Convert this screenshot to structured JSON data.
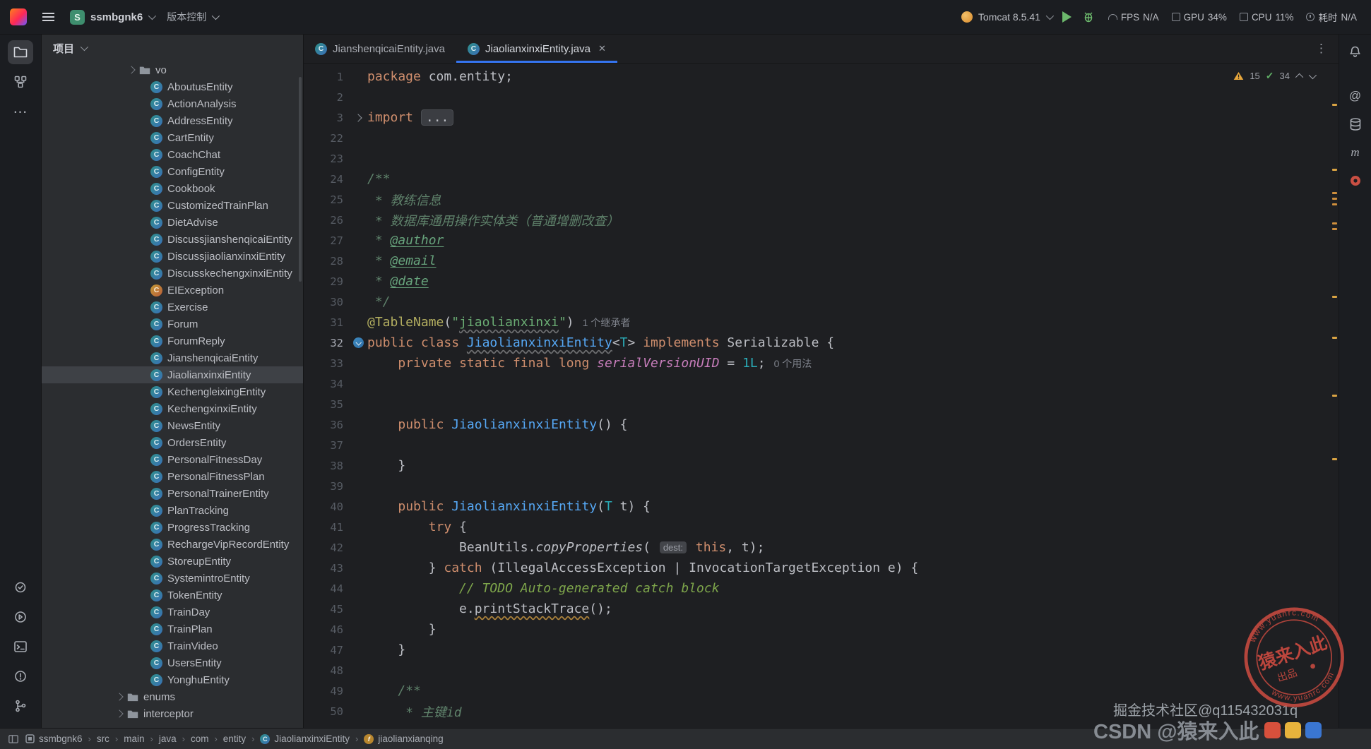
{
  "titlebar": {
    "project_badge": "S",
    "project_name": "ssmbgnk6",
    "vcs_label": "版本控制",
    "run_config": "Tomcat 8.5.41",
    "stats": [
      {
        "key": "fps",
        "icon": "gauge",
        "label": "FPS",
        "value": "N/A"
      },
      {
        "key": "gpu",
        "icon": "chip",
        "label": "GPU",
        "value": "34%"
      },
      {
        "key": "cpu",
        "icon": "chip",
        "label": "CPU",
        "value": "11%"
      },
      {
        "key": "time",
        "icon": "clock",
        "label": "耗时",
        "value": "N/A"
      }
    ]
  },
  "left_toolbar": {
    "top": [
      {
        "name": "project",
        "active": true
      },
      {
        "name": "structure",
        "active": false
      },
      {
        "name": "more",
        "active": false
      }
    ],
    "bottom": [
      {
        "name": "commit"
      },
      {
        "name": "services"
      },
      {
        "name": "terminal"
      },
      {
        "name": "problems"
      },
      {
        "name": "git"
      }
    ]
  },
  "right_toolbar": {
    "icons": [
      {
        "name": "notifications",
        "gap": true
      },
      {
        "name": "ai"
      },
      {
        "name": "database"
      },
      {
        "name": "maven"
      },
      {
        "name": "plugin"
      }
    ]
  },
  "project_panel": {
    "title": "项目",
    "items": [
      {
        "label": "vo",
        "icon": "folder",
        "chev": true,
        "ind": 123
      },
      {
        "label": "AboutusEntity",
        "icon": "class",
        "sp": true,
        "ind": 133
      },
      {
        "label": "ActionAnalysis",
        "icon": "class",
        "sp": true,
        "ind": 133
      },
      {
        "label": "AddressEntity",
        "icon": "class",
        "sp": true,
        "ind": 133
      },
      {
        "label": "CartEntity",
        "icon": "class",
        "sp": true,
        "ind": 133
      },
      {
        "label": "CoachChat",
        "icon": "class",
        "sp": true,
        "ind": 133
      },
      {
        "label": "ConfigEntity",
        "icon": "class",
        "sp": true,
        "ind": 133
      },
      {
        "label": "Cookbook",
        "icon": "class",
        "sp": true,
        "ind": 133
      },
      {
        "label": "CustomizedTrainPlan",
        "icon": "class",
        "sp": true,
        "ind": 133
      },
      {
        "label": "DietAdvise",
        "icon": "class",
        "sp": true,
        "ind": 133
      },
      {
        "label": "DiscussjianshenqicaiEntity",
        "icon": "class",
        "sp": true,
        "ind": 133
      },
      {
        "label": "DiscussjiaolianxinxiEntity",
        "icon": "class",
        "sp": true,
        "ind": 133
      },
      {
        "label": "DiscusskechengxinxiEntity",
        "icon": "class",
        "sp": true,
        "ind": 133
      },
      {
        "label": "EIException",
        "icon": "classx",
        "sp": true,
        "ind": 133
      },
      {
        "label": "Exercise",
        "icon": "class",
        "sp": true,
        "ind": 133
      },
      {
        "label": "Forum",
        "icon": "class",
        "sp": true,
        "ind": 133
      },
      {
        "label": "ForumReply",
        "icon": "class",
        "sp": true,
        "ind": 133
      },
      {
        "label": "JianshenqicaiEntity",
        "icon": "class",
        "sp": true,
        "ind": 133
      },
      {
        "label": "JiaolianxinxiEntity",
        "icon": "class",
        "sp": true,
        "ind": 133,
        "selected": true
      },
      {
        "label": "KechengleixingEntity",
        "icon": "class",
        "sp": true,
        "ind": 133
      },
      {
        "label": "KechengxinxiEntity",
        "icon": "class",
        "sp": true,
        "ind": 133
      },
      {
        "label": "NewsEntity",
        "icon": "class",
        "sp": true,
        "ind": 133
      },
      {
        "label": "OrdersEntity",
        "icon": "class",
        "sp": true,
        "ind": 133
      },
      {
        "label": "PersonalFitnessDay",
        "icon": "class",
        "sp": true,
        "ind": 133
      },
      {
        "label": "PersonalFitnessPlan",
        "icon": "class",
        "sp": true,
        "ind": 133
      },
      {
        "label": "PersonalTrainerEntity",
        "icon": "class",
        "sp": true,
        "ind": 133
      },
      {
        "label": "PlanTracking",
        "icon": "class",
        "sp": true,
        "ind": 133
      },
      {
        "label": "ProgressTracking",
        "icon": "class",
        "sp": true,
        "ind": 133
      },
      {
        "label": "RechargeVipRecordEntity",
        "icon": "class",
        "sp": true,
        "ind": 133
      },
      {
        "label": "StoreupEntity",
        "icon": "class",
        "sp": true,
        "ind": 133
      },
      {
        "label": "SystemintroEntity",
        "icon": "class",
        "sp": true,
        "ind": 133
      },
      {
        "label": "TokenEntity",
        "icon": "class",
        "sp": true,
        "ind": 133
      },
      {
        "label": "TrainDay",
        "icon": "class",
        "sp": true,
        "ind": 133
      },
      {
        "label": "TrainPlan",
        "icon": "class",
        "sp": true,
        "ind": 133
      },
      {
        "label": "TrainVideo",
        "icon": "class",
        "sp": true,
        "ind": 133
      },
      {
        "label": "UsersEntity",
        "icon": "class",
        "sp": true,
        "ind": 133
      },
      {
        "label": "YonghuEntity",
        "icon": "class",
        "sp": true,
        "ind": 133
      },
      {
        "label": "enums",
        "icon": "folder",
        "chev": true,
        "ind": 106
      },
      {
        "label": "interceptor",
        "icon": "folder",
        "chev": true,
        "ind": 106
      }
    ]
  },
  "editor": {
    "tabs": [
      {
        "label": "JianshenqicaiEntity.java",
        "icon": "class",
        "active": false
      },
      {
        "label": "JiaolianxinxiEntity.java",
        "icon": "class",
        "active": true,
        "close": "✕"
      }
    ],
    "kebab": "⋮",
    "inspections": {
      "warnings": "15",
      "passed": "34"
    },
    "code": [
      {
        "n": "1",
        "t": [
          [
            "kw",
            "package"
          ],
          [
            "d",
            " com.entity;"
          ]
        ]
      },
      {
        "n": "2",
        "t": []
      },
      {
        "n": "3",
        "g": "fold",
        "t": [
          [
            "kw",
            "import"
          ],
          [
            "d",
            " "
          ],
          [
            "fold",
            "..."
          ]
        ]
      },
      {
        "n": "22",
        "t": []
      },
      {
        "n": "23",
        "t": []
      },
      {
        "n": "24",
        "t": [
          [
            "doc",
            "/**"
          ]
        ]
      },
      {
        "n": "25",
        "t": [
          [
            "doc",
            " * 教练信息"
          ]
        ]
      },
      {
        "n": "26",
        "t": [
          [
            "doc",
            " * 数据库通用操作实体类（普通增删改查）"
          ]
        ]
      },
      {
        "n": "27",
        "t": [
          [
            "doc",
            " * "
          ],
          [
            "dt",
            "@author"
          ]
        ]
      },
      {
        "n": "28",
        "t": [
          [
            "doc",
            " * "
          ],
          [
            "dt",
            "@email"
          ]
        ]
      },
      {
        "n": "29",
        "t": [
          [
            "doc",
            " * "
          ],
          [
            "dt",
            "@date"
          ]
        ]
      },
      {
        "n": "30",
        "t": [
          [
            "doc",
            " */"
          ]
        ]
      },
      {
        "n": "31",
        "t": [
          [
            "ann",
            "@TableName"
          ],
          [
            "d",
            "("
          ],
          [
            "str",
            "\""
          ],
          [
            "strw",
            "jiaolianxinxi"
          ],
          [
            "str",
            "\""
          ],
          [
            "d",
            ")"
          ],
          [
            "inlay",
            "1 个继承者"
          ]
        ]
      },
      {
        "n": "32",
        "g": "impl",
        "cur": true,
        "t": [
          [
            "kw",
            "public"
          ],
          [
            "d",
            " "
          ],
          [
            "kw",
            "class"
          ],
          [
            "d",
            " "
          ],
          [
            "ctorw",
            "JiaolianxinxiEntity"
          ],
          [
            "d",
            "<"
          ],
          [
            "tp",
            "T"
          ],
          [
            "d",
            "> "
          ],
          [
            "kw",
            "implements"
          ],
          [
            "d",
            " Serializable {"
          ]
        ]
      },
      {
        "n": "33",
        "t": [
          [
            "d",
            "    "
          ],
          [
            "kw",
            "private"
          ],
          [
            "d",
            " "
          ],
          [
            "kw",
            "static"
          ],
          [
            "d",
            " "
          ],
          [
            "kw",
            "final"
          ],
          [
            "d",
            " "
          ],
          [
            "kw",
            "long"
          ],
          [
            "d",
            " "
          ],
          [
            "fld",
            "serialVersionUID"
          ],
          [
            "d",
            " = "
          ],
          [
            "num",
            "1L"
          ],
          [
            "d",
            ";"
          ],
          [
            "inlay",
            "0 个用法"
          ]
        ]
      },
      {
        "n": "34",
        "t": []
      },
      {
        "n": "35",
        "t": []
      },
      {
        "n": "36",
        "t": [
          [
            "d",
            "    "
          ],
          [
            "kw",
            "public"
          ],
          [
            "d",
            " "
          ],
          [
            "ctor",
            "JiaolianxinxiEntity"
          ],
          [
            "d",
            "() {"
          ]
        ]
      },
      {
        "n": "37",
        "t": []
      },
      {
        "n": "38",
        "t": [
          [
            "d",
            "    }"
          ]
        ]
      },
      {
        "n": "39",
        "t": []
      },
      {
        "n": "40",
        "t": [
          [
            "d",
            "    "
          ],
          [
            "kw",
            "public"
          ],
          [
            "d",
            " "
          ],
          [
            "ctor",
            "JiaolianxinxiEntity"
          ],
          [
            "d",
            "("
          ],
          [
            "tp",
            "T"
          ],
          [
            "d",
            " t) {"
          ]
        ]
      },
      {
        "n": "41",
        "t": [
          [
            "d",
            "        "
          ],
          [
            "kw",
            "try"
          ],
          [
            "d",
            " {"
          ]
        ]
      },
      {
        "n": "42",
        "t": [
          [
            "d",
            "            BeanUtils."
          ],
          [
            "sm",
            "copyProperties"
          ],
          [
            "d",
            "( "
          ],
          [
            "inlayp",
            "dest:"
          ],
          [
            "d",
            " "
          ],
          [
            "kw",
            "this"
          ],
          [
            "d",
            ", t);"
          ]
        ]
      },
      {
        "n": "43",
        "t": [
          [
            "d",
            "        } "
          ],
          [
            "kw",
            "catch"
          ],
          [
            "d",
            " (IllegalAccessException | InvocationTargetException e) {"
          ]
        ]
      },
      {
        "n": "44",
        "t": [
          [
            "d",
            "            "
          ],
          [
            "todo",
            "// TODO Auto-generated catch block"
          ]
        ]
      },
      {
        "n": "45",
        "t": [
          [
            "d",
            "            e."
          ],
          [
            "mw",
            "printStackTrace"
          ],
          [
            "d",
            "();"
          ]
        ]
      },
      {
        "n": "46",
        "t": [
          [
            "d",
            "        }"
          ]
        ]
      },
      {
        "n": "47",
        "t": [
          [
            "d",
            "    }"
          ]
        ]
      },
      {
        "n": "48",
        "t": []
      },
      {
        "n": "49",
        "t": [
          [
            "doc",
            "    /**"
          ]
        ]
      },
      {
        "n": "50",
        "t": [
          [
            "doc",
            "     * 主键id"
          ]
        ]
      }
    ]
  },
  "status_bar": {
    "separator": "›",
    "breadcrumbs": [
      {
        "label": "ssmbgnk6",
        "icon": "module"
      },
      {
        "label": "src"
      },
      {
        "label": "main"
      },
      {
        "label": "java"
      },
      {
        "label": "com"
      },
      {
        "label": "entity"
      },
      {
        "label": "JiaolianxinxiEntity",
        "icon": "class"
      },
      {
        "label": "jiaolianxianqing",
        "icon": "field"
      }
    ]
  },
  "watermark": {
    "line1": "掘金技术社区@q115432031q",
    "line2": "CSDN @猿来入此",
    "badge_colors": [
      "#D7503C",
      "#E8B33C",
      "#3A76D2"
    ],
    "stamp": {
      "title": "猿来入此",
      "sub": "出品",
      "arc_top": "www.yuanrc.com",
      "arc_bottom": "www.yuanrc.com"
    }
  }
}
